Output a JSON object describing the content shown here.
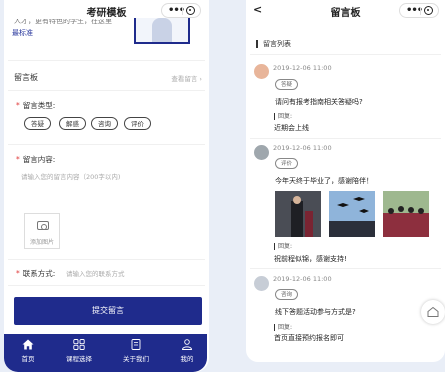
{
  "left": {
    "nav_title": "考研模板",
    "top_partial_text": "人才，更有特色的学生，在这里",
    "top_link": "最标准",
    "section_title": "留言板",
    "section_more": "查看留言 ›",
    "type_label": "留言类型:",
    "type_chips": [
      "答疑",
      "解惑",
      "咨询",
      "评价"
    ],
    "content_label": "留言内容:",
    "content_placeholder": "请输入您的留言内容（200字以内)",
    "upload_label": "添加图片",
    "contact_label": "联系方式:",
    "contact_placeholder": "请输入您的联系方式",
    "submit_label": "提交留言",
    "tabs": [
      "首页",
      "课程选择",
      "关于我们",
      "我的"
    ]
  },
  "right": {
    "nav_title": "留言板",
    "list_title": "留言列表",
    "messages": [
      {
        "date": "2019-12-06 11:00",
        "tag": "答疑",
        "text": "请问有报考指南相关答疑吗?",
        "reply_label": "回复:",
        "reply": "近期会上线"
      },
      {
        "date": "2019-12-06 11:00",
        "tag": "评价",
        "text": "今年天终于毕业了，感谢陪伴！",
        "reply_label": "回复:",
        "reply": "祝前程似锦，感谢支持!"
      },
      {
        "date": "2019-12-06 11:00",
        "tag": "咨询",
        "text": "线下答题活动参与方式是?",
        "reply_label": "回复:",
        "reply": "首页直接预约报名即可"
      }
    ]
  },
  "colors": {
    "brand": "#1f2b8c",
    "required": "#e03b3b",
    "background": "#e9eef7"
  },
  "icons": {
    "more": "more-dots-icon",
    "close": "capsule-close-icon",
    "back": "back-arrow-icon",
    "camera": "camera-icon",
    "home": "home-icon",
    "course": "grid-icon",
    "about": "document-icon",
    "mine": "user-icon"
  }
}
